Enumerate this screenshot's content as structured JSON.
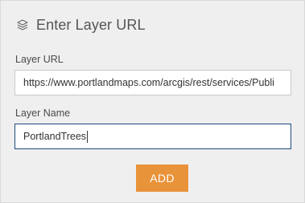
{
  "header": {
    "title": "Enter Layer URL",
    "icon": "layers-icon"
  },
  "form": {
    "url_label": "Layer URL",
    "url_value": "https://www.portlandmaps.com/arcgis/rest/services/Publi",
    "name_label": "Layer Name",
    "name_value": "PortlandTrees",
    "add_label": "ADD"
  },
  "colors": {
    "accent_button": "#e8933a",
    "focused_border": "#1f4c7c",
    "panel_background": "#efefef"
  }
}
